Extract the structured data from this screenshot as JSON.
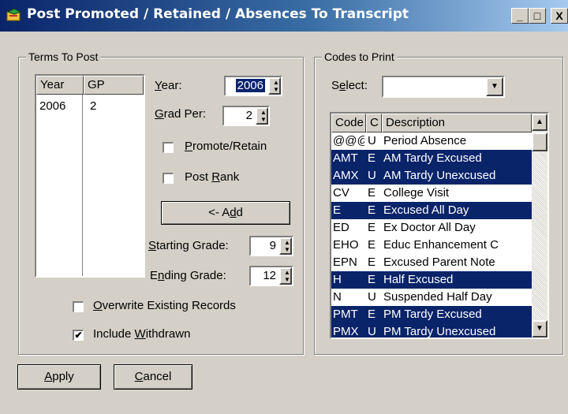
{
  "window": {
    "title": "Post Promoted / Retained / Absences To Transcript",
    "minimize_glyph": "_",
    "maximize_glyph": "□",
    "close_glyph": "X",
    "icon": "graduation-app-icon"
  },
  "terms": {
    "group_label": "Terms To Post",
    "columns": [
      "Year",
      "GP"
    ],
    "rows": [
      {
        "year": "2006",
        "gp": "2"
      }
    ],
    "year_label": "Year:",
    "year_value": "2006",
    "gradper_label": "Grad Per:",
    "gradper_value": "2",
    "promote_label": "Promote/Retain",
    "promote_checked": false,
    "postrank_label": "Post Rank",
    "postrank_checked": false,
    "add_label": "<- Add",
    "start_label": "Starting Grade:",
    "start_value": "9",
    "end_label": "Ending Grade:",
    "end_value": "12",
    "overwrite_label": "Overwrite Existing Records",
    "overwrite_checked": false,
    "withdrawn_label": "Include Withdrawn",
    "withdrawn_checked": true
  },
  "codes": {
    "group_label": "Codes to Print",
    "select_label": "Select:",
    "select_value": "",
    "columns": [
      "Code",
      "C",
      "Description"
    ],
    "rows": [
      {
        "code": "@@@",
        "c": "U",
        "desc": "Period Absence",
        "selected": false
      },
      {
        "code": "AMT",
        "c": "E",
        "desc": "AM Tardy Excused",
        "selected": true
      },
      {
        "code": "AMX",
        "c": "U",
        "desc": "AM Tardy Unexcused",
        "selected": true
      },
      {
        "code": "CV",
        "c": "E",
        "desc": "College Visit",
        "selected": false
      },
      {
        "code": "E",
        "c": "E",
        "desc": "Excused All Day",
        "selected": true
      },
      {
        "code": "ED",
        "c": "E",
        "desc": "Ex Doctor All Day",
        "selected": false
      },
      {
        "code": "EHO",
        "c": "E",
        "desc": "Educ Enhancement C",
        "selected": false
      },
      {
        "code": "EPN",
        "c": "E",
        "desc": "Excused Parent Note",
        "selected": false
      },
      {
        "code": "H",
        "c": "E",
        "desc": "Half Excused",
        "selected": true
      },
      {
        "code": "N",
        "c": "U",
        "desc": "Suspended Half Day",
        "selected": false
      },
      {
        "code": "PMT",
        "c": "E",
        "desc": "PM Tardy Excused",
        "selected": true
      },
      {
        "code": "PMX",
        "c": "U",
        "desc": "PM Tardy Unexcused",
        "selected": true
      }
    ]
  },
  "footer": {
    "apply_label": "Apply",
    "cancel_label": "Cancel"
  },
  "colors": {
    "selection": "#0a246a",
    "face": "#d4d0c8",
    "title_start": "#0a246a",
    "title_end": "#a6caf0"
  }
}
